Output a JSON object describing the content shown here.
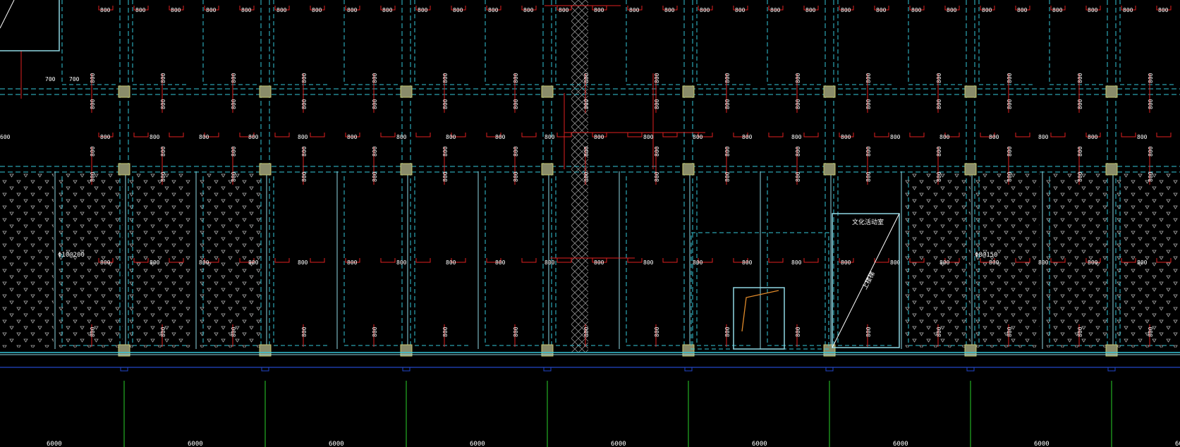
{
  "colors": {
    "background": "#000000",
    "wall_dash": "#35c6d8",
    "wall_solid": "#8fd8e4",
    "beam": "#e02020",
    "column_fill": "#8a8c6a",
    "column_stroke": "#c8c870",
    "grid_axis": "#2ad22a",
    "foundation": "#2246c8",
    "hatch": "#a8a8a8",
    "text": "#ffffff",
    "opening": "#e08a2a"
  },
  "labels": {
    "top_row": [
      "800",
      "800",
      "800",
      "800",
      "800",
      "800",
      "800",
      "800",
      "800",
      "800",
      "800",
      "800",
      "800",
      "800",
      "800",
      "800",
      "800",
      "800",
      "800",
      "800",
      "800",
      "800",
      "800",
      "800",
      "800",
      "800",
      "800",
      "800",
      "800",
      "800",
      "800",
      "800"
    ],
    "mid_row": [
      "800",
      "800",
      "800",
      "800",
      "800",
      "800",
      "800",
      "800",
      "800",
      "800",
      "800",
      "800",
      "800",
      "800",
      "800",
      "800",
      "800",
      "800",
      "800",
      "800",
      "800",
      "800",
      "800"
    ],
    "rebar_left": "Φ10@200",
    "rebar_right": "Φ8@150",
    "room_label": "文化活动室",
    "stair_label": "上楼梯",
    "small_700": "700",
    "small_600": "600",
    "dim_600": "600",
    "bottom_dims": [
      "6000",
      "6000",
      "6000",
      "6000",
      "6000",
      "6000",
      "6000",
      "6000",
      "6000"
    ]
  },
  "icons": {
    "column": "square-column-icon",
    "hatch": "triangle-hatch-pattern"
  }
}
